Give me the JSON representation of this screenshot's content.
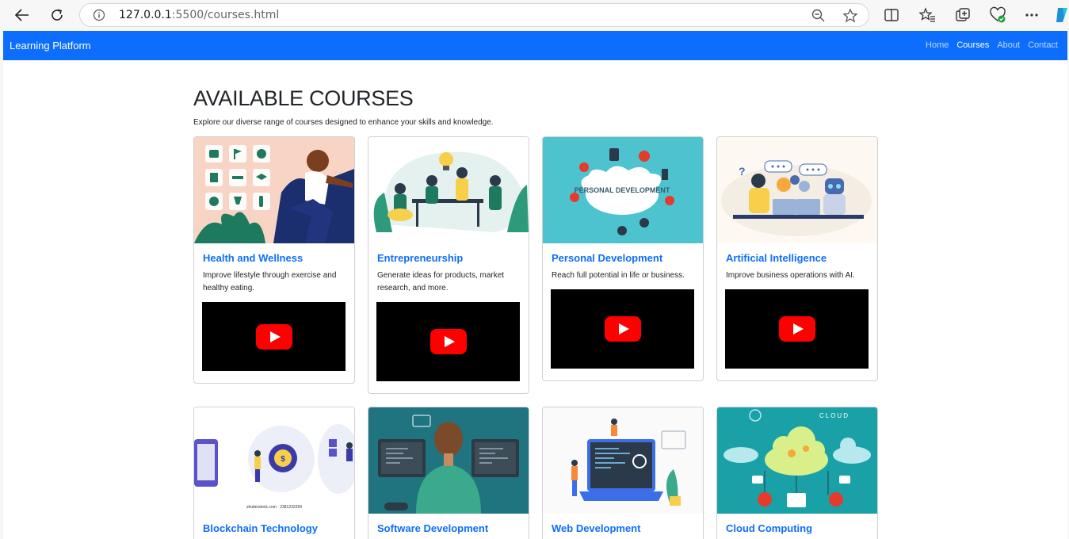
{
  "browser": {
    "url_host": "127.0.0.1",
    "url_rest": ":5500/courses.html"
  },
  "navbar": {
    "brand": "Learning Platform",
    "links": [
      "Home",
      "Courses",
      "About",
      "Contact"
    ],
    "active": "Courses",
    "color": "#0d6efd"
  },
  "main": {
    "heading": "AVAILABLE COURSES",
    "lead": "Explore our diverse range of courses designed to enhance your skills and knowledge."
  },
  "courses": [
    {
      "title": "Health and Wellness",
      "text": "Improve lifestyle through exercise and healthy eating.",
      "image": "health-illustration",
      "video": "youtube-video"
    },
    {
      "title": "Entrepreneurship",
      "text": "Generate ideas for products, market research, and more.",
      "image": "team-meeting-illustration",
      "video": "youtube-video"
    },
    {
      "title": "Personal Development",
      "text": "Reach full potential in life or business.",
      "image": "personal-development-illustration",
      "image_text": "PERSONAL DEVELOPMENT",
      "video": "youtube-video"
    },
    {
      "title": "Artificial Intelligence",
      "text": "Improve business operations with AI.",
      "image": "ai-robot-illustration",
      "video": "youtube-video"
    },
    {
      "title": "Blockchain Technology",
      "text": "",
      "image": "blockchain-illustration",
      "image_text": "shutterstock.com · 2381232269"
    },
    {
      "title": "Software Development",
      "text": "",
      "image": "developer-illustration"
    },
    {
      "title": "Web Development",
      "text": "",
      "image": "web-dev-illustration"
    },
    {
      "title": "Cloud Computing",
      "text": "",
      "image": "cloud-illustration",
      "image_text": "CLOUD"
    }
  ]
}
